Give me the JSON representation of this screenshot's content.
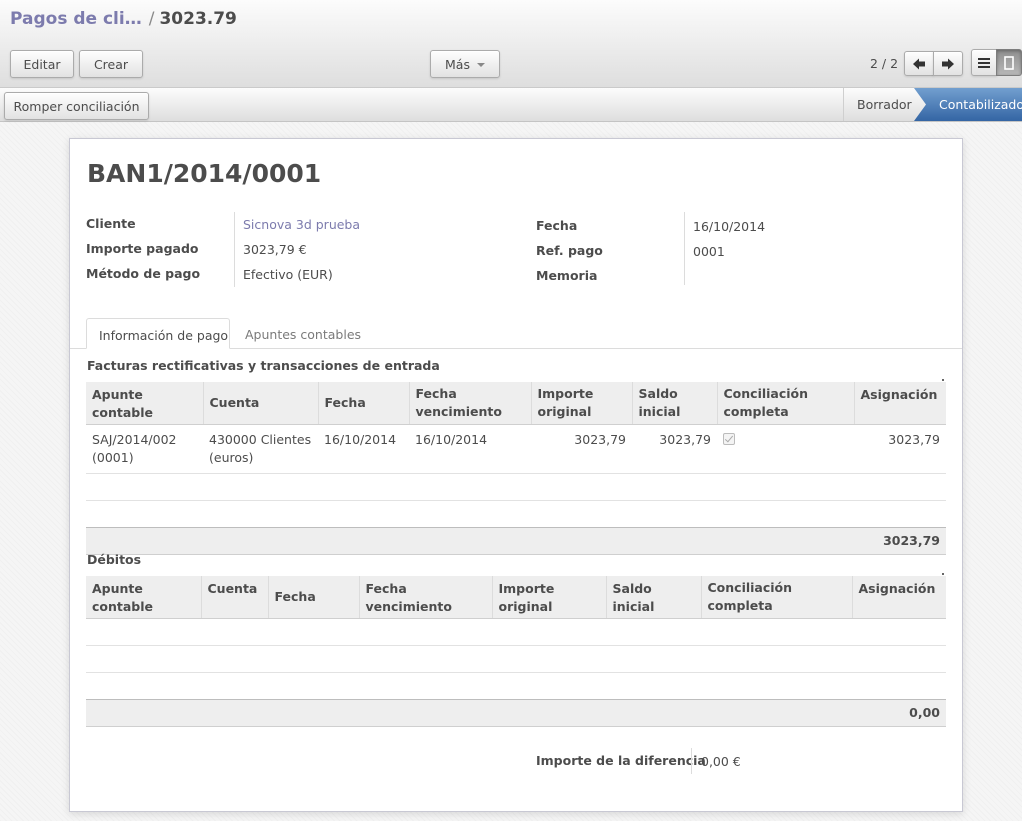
{
  "breadcrumb": {
    "parent": "Pagos de cli…",
    "separator": "/",
    "current": "3023.79"
  },
  "toolbar": {
    "edit_label": "Editar",
    "create_label": "Crear",
    "more_label": "Más"
  },
  "pager": {
    "value": "2 / 2"
  },
  "statusbar": {
    "unreconcile_label": "Romper conciliación",
    "stages": [
      "Borrador",
      "Contabilizado"
    ],
    "active_stage": "Contabilizado",
    "active_color": "#3465a4"
  },
  "record": {
    "title": "BAN1/2014/0001",
    "fields_left": [
      {
        "label": "Cliente",
        "value": "Sicnova 3d prueba"
      },
      {
        "label": "Importe pagado",
        "value": "3023,79 €"
      },
      {
        "label": "Método de pago",
        "value": "Efectivo (EUR)"
      }
    ],
    "fields_right": [
      {
        "label": "Fecha",
        "value": "16/10/2014"
      },
      {
        "label": "Ref. pago",
        "value": "0001"
      },
      {
        "label": "Memoria",
        "value": ""
      }
    ]
  },
  "tabs": [
    {
      "label": "Información de pago",
      "active": true
    },
    {
      "label": "Apuntes contables",
      "active": false
    }
  ],
  "credits": {
    "title": "Facturas rectificativas y transacciones de entrada",
    "columns": [
      "Apunte contable",
      "Cuenta",
      "Fecha",
      "Fecha vencimiento",
      "Importe original",
      "Saldo inicial",
      "Conciliación completa",
      "Asignación"
    ],
    "rows": [
      {
        "move_line": "SAJ/2014/002 (0001)",
        "account": "430000 Clientes (euros)",
        "date": "16/10/2014",
        "due_date": "16/10/2014",
        "original": "3023,79",
        "opening": "3023,79",
        "reconcile": true,
        "amount": "3023,79"
      }
    ],
    "total": "3023,79"
  },
  "debits": {
    "title": "Débitos",
    "columns": [
      "Apunte contable",
      "Cuenta",
      "Fecha",
      "Fecha vencimiento",
      "Importe original",
      "Saldo inicial",
      "Conciliación completa",
      "Asignación"
    ],
    "rows": [],
    "total": "0,00"
  },
  "difference": {
    "label": "Importe de la diferencia",
    "value": "0,00 €"
  },
  "colors": {
    "link": "#7c7bad",
    "accent": "#3465a4"
  }
}
